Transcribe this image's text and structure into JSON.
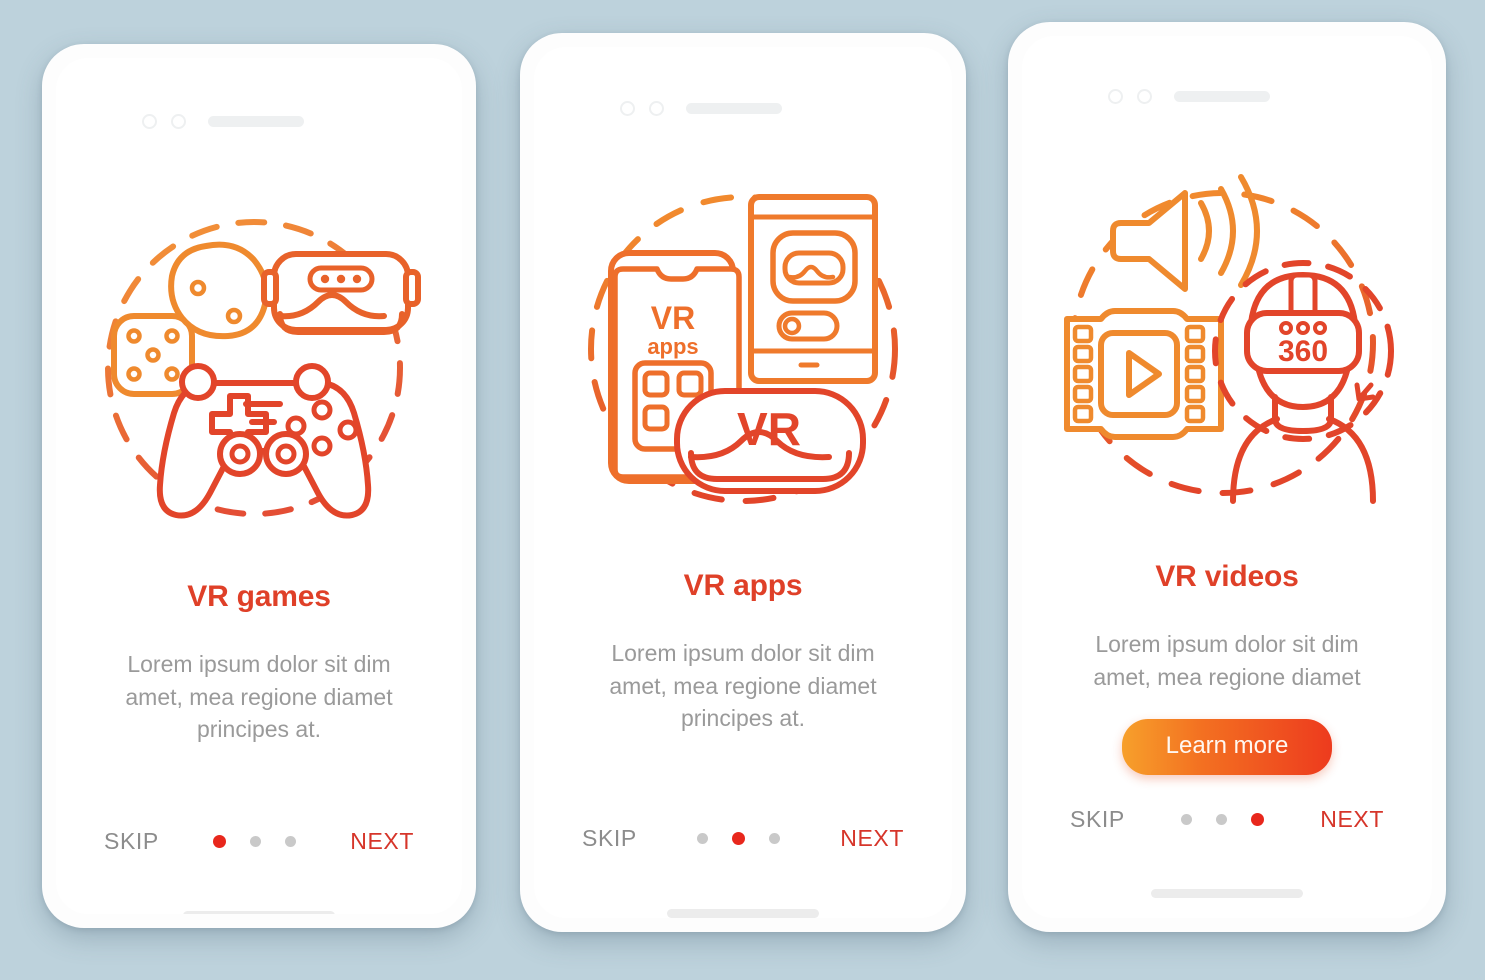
{
  "background_color": "#bdd2dc",
  "accent": {
    "title_color": "#df4028",
    "next_color": "#d6352a",
    "skip_color": "#8c8c8c",
    "body_color": "#9a9a9a",
    "dot_active_color": "#e8271c",
    "dot_inactive_color": "#c9c9c9",
    "illustration_orange": "#f08030",
    "illustration_red": "#e2452a",
    "cta_gradient_from": "#f7a02b",
    "cta_gradient_to": "#ed3b1e"
  },
  "screens": [
    {
      "id": "vr-games",
      "title": "VR games",
      "body": "Lorem ipsum dolor sit dim amet, mea regione diamet principes at.",
      "body_lines": [
        "Lorem ipsum dolor sit dim",
        "amet, mea regione diamet",
        "principes at."
      ],
      "cta": null,
      "skip_label": "SKIP",
      "next_label": "NEXT",
      "active_dot": 0,
      "dot_count": 3,
      "illustration": {
        "name": "vr-games-illustration",
        "elements": [
          "dice-small-icon",
          "dice-large-icon",
          "vr-headset-icon",
          "gamepad-icon",
          "dashed-circle"
        ]
      }
    },
    {
      "id": "vr-apps",
      "title": "VR apps",
      "body": "Lorem ipsum dolor sit dim amet, mea regione diamet principes at.",
      "body_lines": [
        "Lorem ipsum dolor sit dim",
        "amet, mea regione diamet",
        "principes at."
      ],
      "cta": null,
      "skip_label": "SKIP",
      "next_label": "NEXT",
      "active_dot": 1,
      "dot_count": 3,
      "illustration": {
        "name": "vr-apps-illustration",
        "elements": [
          "phone-front-icon",
          "phone-back-icon",
          "vr-headset-icon",
          "dashed-circle"
        ],
        "labels": [
          "VR",
          "apps",
          "VR"
        ]
      }
    },
    {
      "id": "vr-videos",
      "title": "VR videos",
      "body": "Lorem ipsum dolor sit dim amet, mea regione diamet",
      "body_lines": [
        "Lorem ipsum dolor sit dim",
        "amet, mea regione diamet"
      ],
      "cta": "Learn more",
      "skip_label": "SKIP",
      "next_label": "NEXT",
      "active_dot": 2,
      "dot_count": 3,
      "illustration": {
        "name": "vr-videos-illustration",
        "elements": [
          "speaker-icon",
          "film-strip-icon",
          "play-icon",
          "person-with-vr-headset-icon",
          "dashed-circle",
          "arrow-icon"
        ],
        "labels": [
          "360"
        ]
      }
    }
  ]
}
